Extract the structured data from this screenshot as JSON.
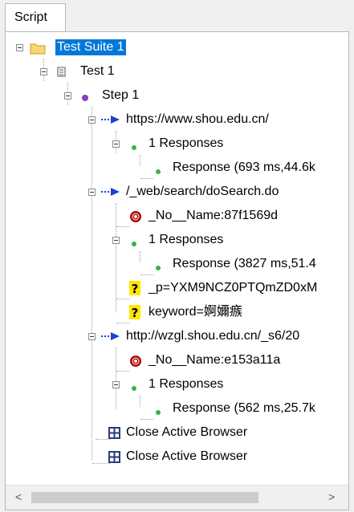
{
  "tab": {
    "label": "Script"
  },
  "tree": {
    "suite": "Test Suite 1",
    "test": "Test 1",
    "step": "Step 1",
    "req1": {
      "url": "https://www.shou.edu.cn/",
      "responses": "1 Responses",
      "response": "Response (693 ms,44.6k"
    },
    "req2": {
      "url": "/_web/search/doSearch.do",
      "param_noname": "_No__Name:87f1569d",
      "responses": "1 Responses",
      "response": "Response (3827 ms,51.4",
      "param_p": "_p=YXM9NCZ0PTQmZD0xM",
      "param_keyword": "keyword=婀嬭瘯"
    },
    "req3": {
      "url": "http://wzgl.shou.edu.cn/_s6/20",
      "param_noname": "_No__Name:e153a11a",
      "responses": "1 Responses",
      "response": "Response (562 ms,25.7k"
    },
    "action1": "Close Active Browser",
    "action2": "Close Active Browser"
  },
  "scrollbar": {
    "left_arrow": "<",
    "right_arrow": ">"
  },
  "colors": {
    "selection": "#0078d7",
    "arrow": "#1e3fd6",
    "param_red": "#b30000",
    "dot_green": "#3cb043",
    "step_purple": "#8a3fb3"
  }
}
